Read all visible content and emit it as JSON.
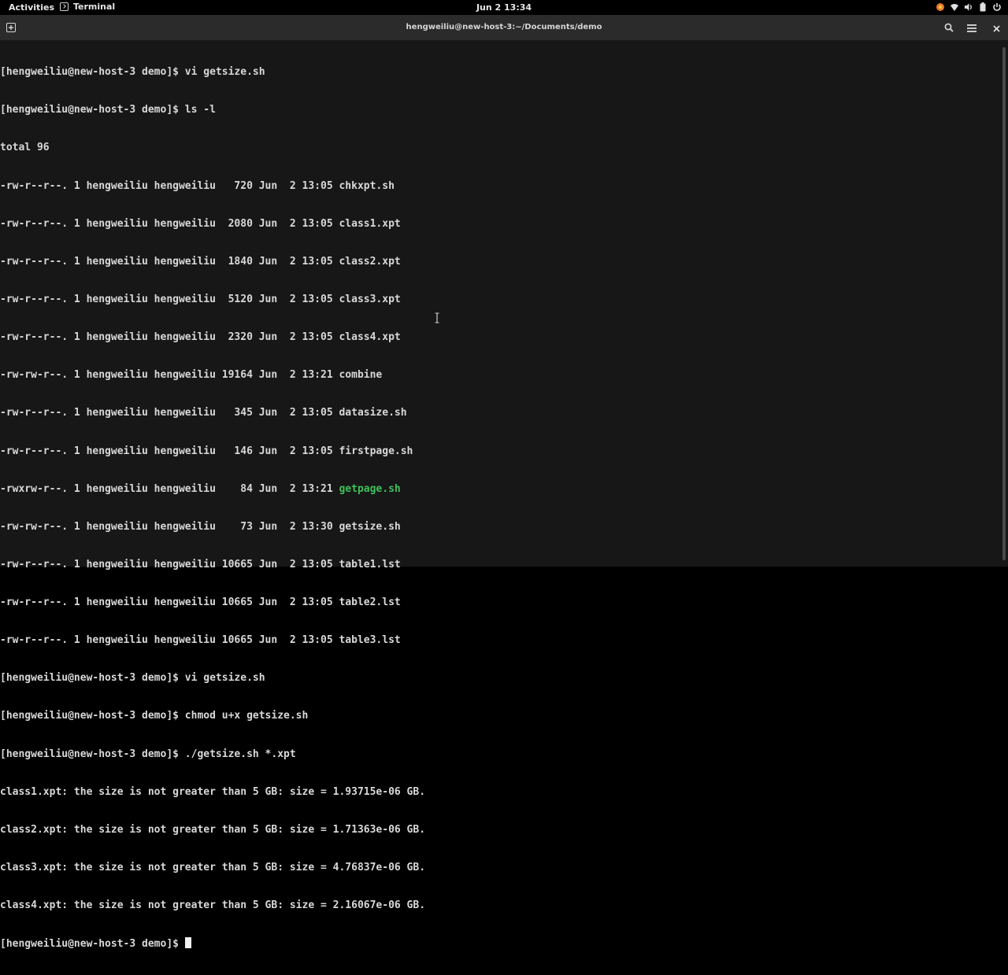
{
  "topbar": {
    "activities": "Activities",
    "app_name": "Terminal",
    "clock": "Jun 2  13:34",
    "tray_icons": [
      "firefox-update-icon",
      "wifi-icon",
      "volume-icon",
      "power-icon"
    ]
  },
  "window": {
    "title": "hengweiliu@new-host-3:~/Documents/demo",
    "buttons": {
      "new_tab": "new-tab-icon",
      "search": "search-icon",
      "menu": "hamburger-menu-icon",
      "close": "close-icon"
    }
  },
  "terminal": {
    "lines": [
      "[hengweiliu@new-host-3 demo]$ vi getsize.sh",
      "[hengweiliu@new-host-3 demo]$ ls -l",
      "total 96",
      "-rw-r--r--. 1 hengweiliu hengweiliu   720 Jun  2 13:05 chkxpt.sh",
      "-rw-r--r--. 1 hengweiliu hengweiliu  2080 Jun  2 13:05 class1.xpt",
      "-rw-r--r--. 1 hengweiliu hengweiliu  1840 Jun  2 13:05 class2.xpt",
      "-rw-r--r--. 1 hengweiliu hengweiliu  5120 Jun  2 13:05 class3.xpt",
      "-rw-r--r--. 1 hengweiliu hengweiliu  2320 Jun  2 13:05 class4.xpt",
      "-rw-rw-r--. 1 hengweiliu hengweiliu 19164 Jun  2 13:21 combine",
      "-rw-r--r--. 1 hengweiliu hengweiliu   345 Jun  2 13:05 datasize.sh",
      "-rw-r--r--. 1 hengweiliu hengweiliu   146 Jun  2 13:05 firstpage.sh",
      {
        "prefix": "-rwxrw-r--. 1 hengweiliu hengweiliu    84 Jun  2 13:21 ",
        "exec": "getpage.sh"
      },
      "-rw-rw-r--. 1 hengweiliu hengweiliu    73 Jun  2 13:30 getsize.sh",
      "-rw-r--r--. 1 hengweiliu hengweiliu 10665 Jun  2 13:05 table1.lst",
      "-rw-r--r--. 1 hengweiliu hengweiliu 10665 Jun  2 13:05 table2.lst",
      "-rw-r--r--. 1 hengweiliu hengweiliu 10665 Jun  2 13:05 table3.lst",
      "[hengweiliu@new-host-3 demo]$ vi getsize.sh",
      "[hengweiliu@new-host-3 demo]$ chmod u+x getsize.sh",
      "[hengweiliu@new-host-3 demo]$ ./getsize.sh *.xpt",
      "class1.xpt: the size is not greater than 5 GB: size = 1.93715e-06 GB.",
      "class2.xpt: the size is not greater than 5 GB: size = 1.71363e-06 GB.",
      "class3.xpt: the size is not greater than 5 GB: size = 4.76837e-06 GB.",
      "class4.xpt: the size is not greater than 5 GB: size = 2.16067e-06 GB."
    ],
    "prompt": "[hengweiliu@new-host-3 demo]$ ",
    "exec_color": "#3ec05a"
  }
}
